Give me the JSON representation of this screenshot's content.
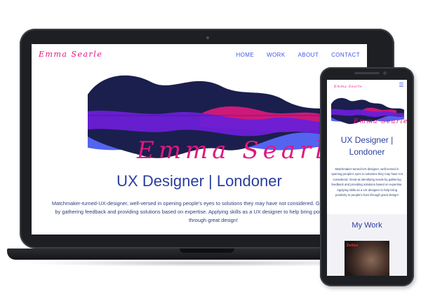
{
  "laptop_site": {
    "logo_text": "Emma Searle",
    "nav": [
      "HOME",
      "WORK",
      "ABOUT",
      "CONTACT"
    ],
    "signature": "Emma Searle",
    "headline": "UX Designer | Londoner",
    "description": "Matchmaker-turned-UX-designer, well-versed in opening people's eyes to solutions they may have not considered. Great at identifying needs by gathering feedback and providing solutions based on expertise. Applying skills as a UX designer to help bring positivity to people's lives through great design!"
  },
  "phone_site": {
    "logo_text": "Emma Searle",
    "menu_icon": "hamburger-icon",
    "signature": "Emma Searle",
    "headline": "UX Designer | Londoner",
    "description": "Matchmaker-turned-UX-designer, well-versed in opening people's eyes to solutions they may have not considered. Great at identifying needs by gathering feedback and providing solutions based on expertise. Applying skills as a UX designer to help bring positivity to people's lives through great design!",
    "work_heading": "My Work",
    "work_card_label": "Zolloo"
  },
  "colors": {
    "brand_pink": "#e0187f",
    "brand_blue": "#3f56e6",
    "navy": "#1b1f4d",
    "purple": "#6a1fd6",
    "heading": "#2a3e9c"
  }
}
